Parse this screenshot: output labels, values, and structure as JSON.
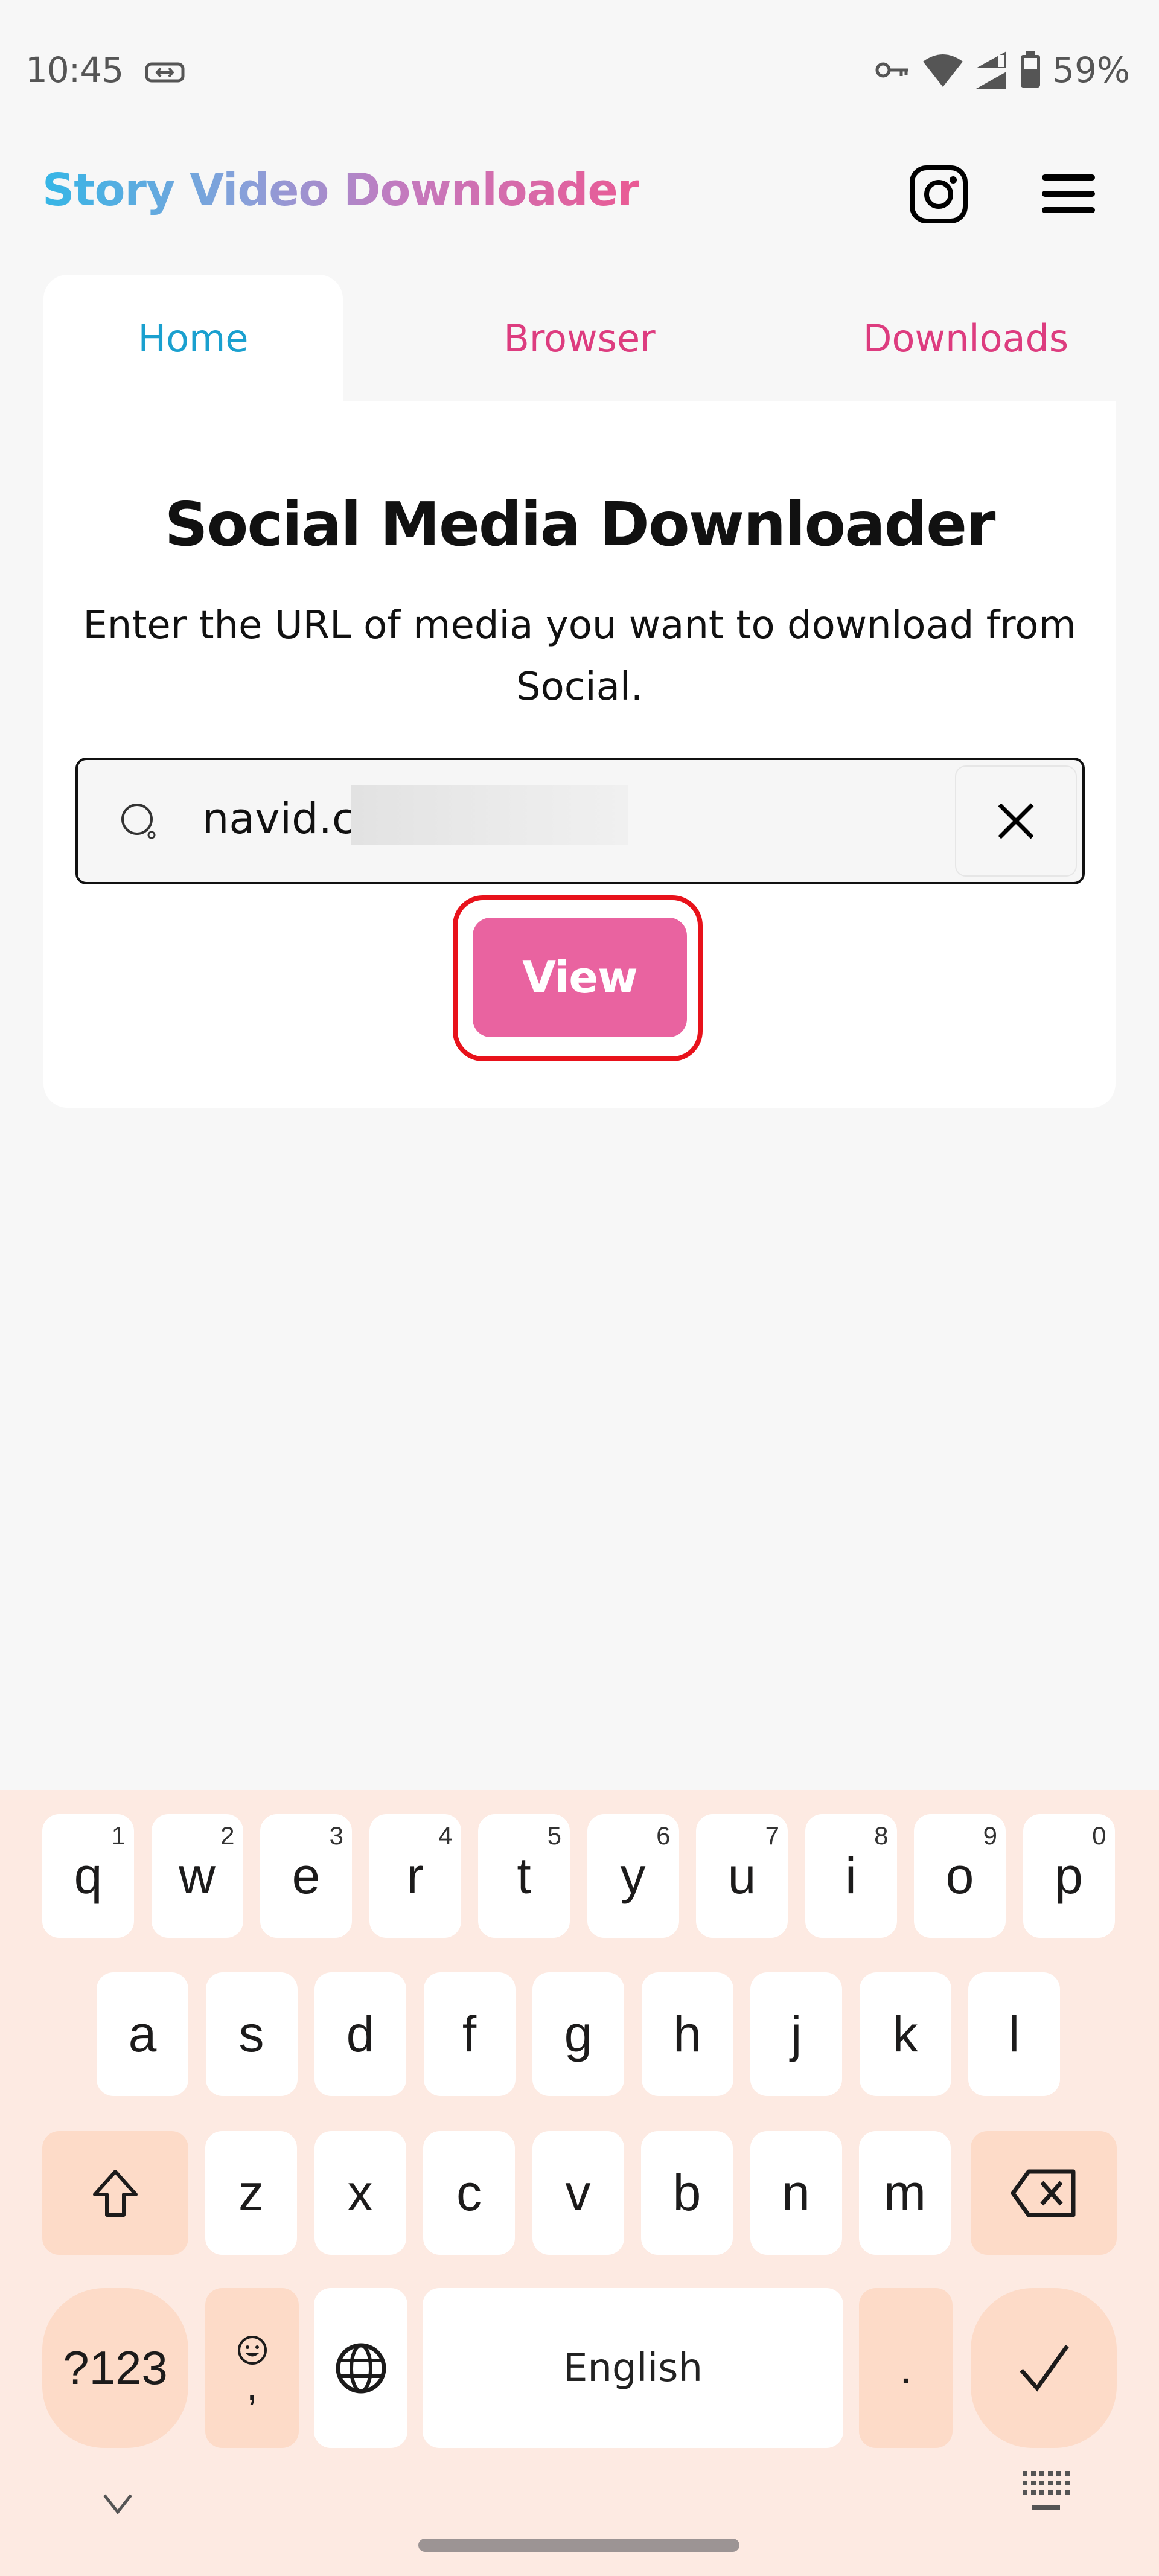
{
  "status_bar": {
    "time": "10:45",
    "battery": "59%",
    "icons": [
      "link-icon",
      "vpn-key-icon",
      "wifi-icon",
      "signal-icon",
      "battery-icon"
    ]
  },
  "header": {
    "title": "Story Video Downloader",
    "title_gradient": [
      "#35b6e6",
      "#8a9fd9",
      "#c37abf",
      "#ea5a94"
    ],
    "icons": [
      "instagram-icon",
      "menu-icon"
    ]
  },
  "tabs": [
    {
      "label": "Home",
      "active": true
    },
    {
      "label": "Browser",
      "active": false
    },
    {
      "label": "Downloads",
      "active": false
    }
  ],
  "main": {
    "heading": "Social Media Downloader",
    "subtitle": "Enter the URL of media  you want to download from Social.",
    "url_input": {
      "value": "navid.c",
      "redacted": true
    },
    "view_button": "View",
    "accent_color": "#e963a0",
    "highlight_color": "#e8121b"
  },
  "keyboard": {
    "row1": [
      {
        "k": "q",
        "n": "1"
      },
      {
        "k": "w",
        "n": "2"
      },
      {
        "k": "e",
        "n": "3"
      },
      {
        "k": "r",
        "n": "4"
      },
      {
        "k": "t",
        "n": "5"
      },
      {
        "k": "y",
        "n": "6"
      },
      {
        "k": "u",
        "n": "7"
      },
      {
        "k": "i",
        "n": "8"
      },
      {
        "k": "o",
        "n": "9"
      },
      {
        "k": "p",
        "n": "0"
      }
    ],
    "row2": [
      "a",
      "s",
      "d",
      "f",
      "g",
      "h",
      "j",
      "k",
      "l"
    ],
    "row3": [
      "z",
      "x",
      "c",
      "v",
      "b",
      "n",
      "m"
    ],
    "symbols_key": "?123",
    "comma_key": ",",
    "space_label": "English",
    "period_key": ".",
    "background": "#fdeae2"
  }
}
